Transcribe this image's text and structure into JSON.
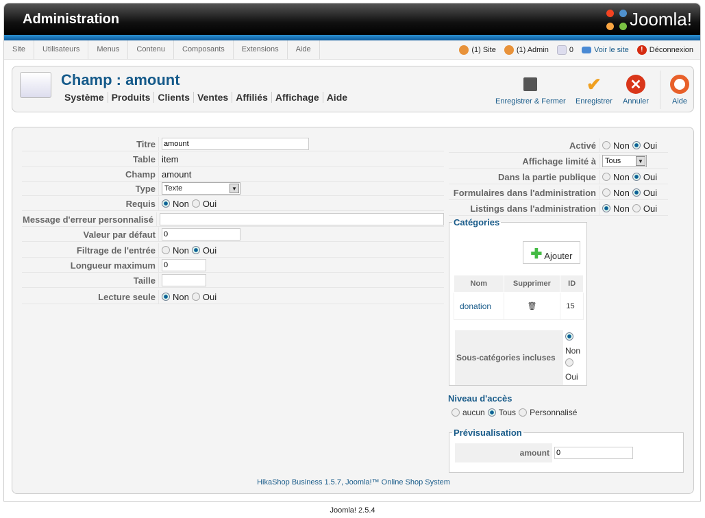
{
  "header": {
    "title": "Administration",
    "logo": "Joomla!"
  },
  "menu": [
    "Site",
    "Utilisateurs",
    "Menus",
    "Contenu",
    "Composants",
    "Extensions",
    "Aide"
  ],
  "status": {
    "site": "(1) Site",
    "admin": "(1) Admin",
    "messages": "0",
    "view_site": "Voir le site",
    "logout": "Déconnexion"
  },
  "toolbar": {
    "title": "Champ : amount",
    "submenu": [
      "Système",
      "Produits",
      "Clients",
      "Ventes",
      "Affiliés",
      "Affichage",
      "Aide"
    ],
    "save_close": "Enregistrer & Fermer",
    "save": "Enregistrer",
    "cancel": "Annuler",
    "help": "Aide"
  },
  "form": {
    "titre": {
      "label": "Titre",
      "value": "amount"
    },
    "table": {
      "label": "Table",
      "value": "item"
    },
    "champ": {
      "label": "Champ",
      "value": "amount"
    },
    "type": {
      "label": "Type",
      "value": "Texte"
    },
    "requis": {
      "label": "Requis",
      "selected": "Non"
    },
    "message": {
      "label": "Message d'erreur personnalisé",
      "value": ""
    },
    "defaut": {
      "label": "Valeur par défaut",
      "value": "0"
    },
    "filtrage": {
      "label": "Filtrage de l'entrée",
      "selected": "Oui"
    },
    "longueur": {
      "label": "Longueur maximum",
      "value": "0"
    },
    "taille": {
      "label": "Taille",
      "value": ""
    },
    "lecture": {
      "label": "Lecture seule",
      "selected": "Non"
    },
    "non": "Non",
    "oui": "Oui"
  },
  "right": {
    "active": {
      "label": "Activé",
      "selected": "Oui"
    },
    "affichage": {
      "label": "Affichage limité à",
      "value": "Tous"
    },
    "publique": {
      "label": "Dans la partie publique",
      "selected": "Oui"
    },
    "formulaires": {
      "label": "Formulaires dans l'administration",
      "selected": "Oui"
    },
    "listings": {
      "label": "Listings dans l'administration",
      "selected": "Non"
    }
  },
  "categories": {
    "legend": "Catégories",
    "add": "Ajouter",
    "headers": [
      "Nom",
      "Supprimer",
      "ID"
    ],
    "rows": [
      {
        "name": "donation",
        "id": "15"
      }
    ],
    "sub_label": "Sous-catégories incluses",
    "sub_selected": "Non"
  },
  "access": {
    "title": "Niveau d'accès",
    "options": [
      "aucun",
      "Tous",
      "Personnalisé"
    ],
    "selected": "Tous"
  },
  "preview": {
    "legend": "Prévisualisation",
    "label": "amount",
    "value": "0"
  },
  "footer": "HikaShop Business 1.5.7, Joomla!™ Online Shop System",
  "version": "Joomla! 2.5.4"
}
